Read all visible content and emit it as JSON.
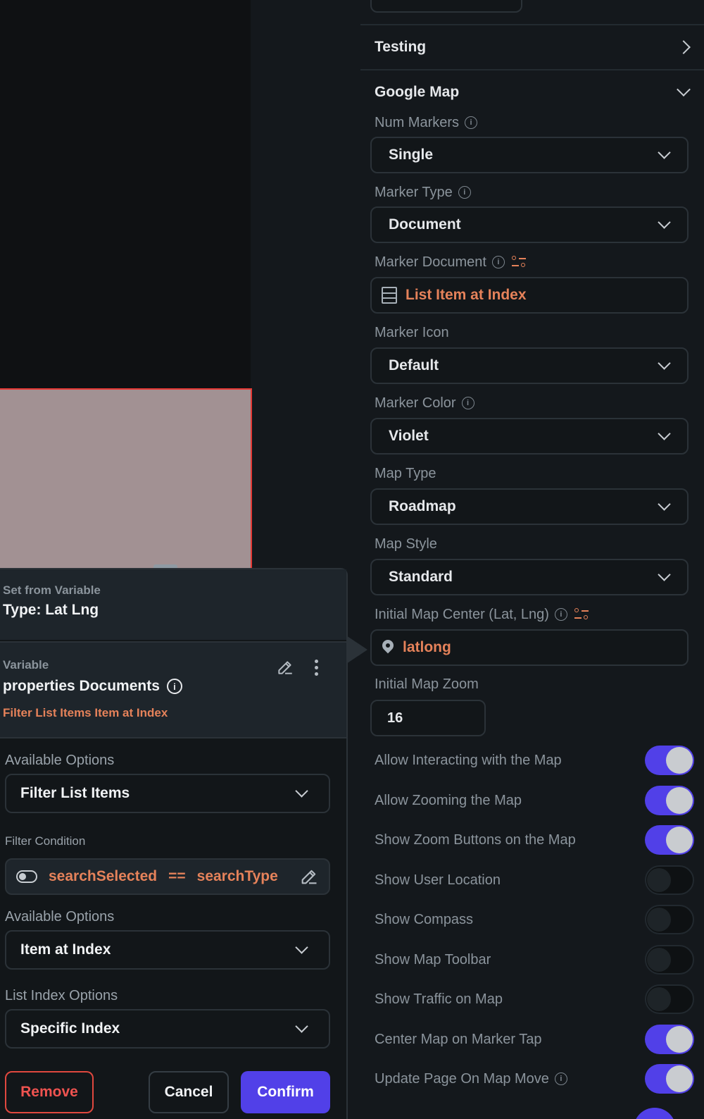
{
  "colors": {
    "accent": "#5140e8",
    "variable_orange": "#e5825a",
    "danger": "#ef5350",
    "selection_border": "#e53935",
    "panel_bg": "#14181c"
  },
  "properties": {
    "testing_section": "Testing",
    "map_section": "Google Map",
    "num_markers": {
      "label": "Num Markers",
      "value": "Single"
    },
    "marker_type": {
      "label": "Marker Type",
      "value": "Document"
    },
    "marker_document": {
      "label": "Marker Document",
      "value": "List Item at Index"
    },
    "marker_icon": {
      "label": "Marker Icon",
      "value": "Default"
    },
    "marker_color": {
      "label": "Marker Color",
      "value": "Violet"
    },
    "map_type": {
      "label": "Map Type",
      "value": "Roadmap"
    },
    "map_style": {
      "label": "Map Style",
      "value": "Standard"
    },
    "initial_center": {
      "label": "Initial Map Center (Lat, Lng)",
      "value": "latlong"
    },
    "initial_zoom": {
      "label": "Initial Map Zoom",
      "value": "16"
    },
    "toggles": [
      {
        "label": "Allow Interacting with the Map",
        "on": true
      },
      {
        "label": "Allow Zooming the Map",
        "on": true
      },
      {
        "label": "Show Zoom Buttons on the Map",
        "on": true
      },
      {
        "label": "Show User Location",
        "on": false
      },
      {
        "label": "Show Compass",
        "on": false
      },
      {
        "label": "Show Map Toolbar",
        "on": false
      },
      {
        "label": "Show Traffic on Map",
        "on": false
      },
      {
        "label": "Center Map on Marker Tap",
        "on": true
      },
      {
        "label": "Update Page On Map Move",
        "on": true
      }
    ]
  },
  "popover": {
    "header_caption": "Set from Variable",
    "header_type": "Type: Lat Lng",
    "variable_caption": "Variable",
    "variable_name": "properties Documents",
    "variable_chain": "Filter List Items Item at Index",
    "available_options_1": {
      "label": "Available Options",
      "value": "Filter List Items"
    },
    "filter_condition": {
      "label": "Filter Condition",
      "left": "searchSelected",
      "operator": "==",
      "right": "searchType"
    },
    "available_options_2": {
      "label": "Available Options",
      "value": "Item at Index"
    },
    "list_index_options": {
      "label": "List Index Options",
      "value": "Specific Index"
    },
    "buttons": {
      "remove": "Remove",
      "cancel": "Cancel",
      "confirm": "Confirm"
    }
  }
}
